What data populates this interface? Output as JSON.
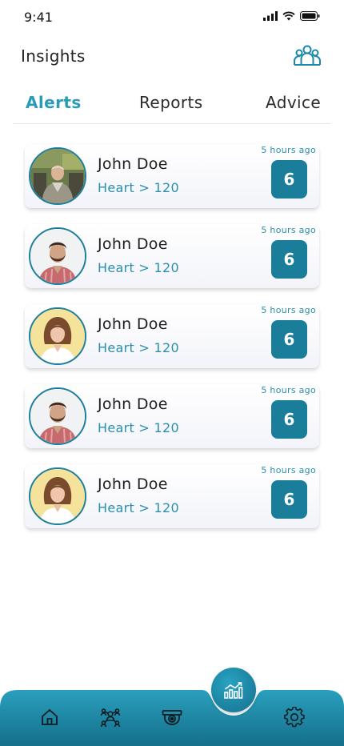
{
  "status_bar": {
    "time": "9:41"
  },
  "header": {
    "title": "Insights",
    "icon": "group-icon"
  },
  "tabs": [
    {
      "label": "Alerts",
      "active": true
    },
    {
      "label": "Reports",
      "active": false
    },
    {
      "label": "Advice",
      "active": false
    }
  ],
  "alerts": [
    {
      "name": "John Doe",
      "metric": "Heart > 120",
      "time": "5 hours ago",
      "count": "6",
      "avatar": "elderly-man-photo"
    },
    {
      "name": "John Doe",
      "metric": "Heart > 120",
      "time": "5 hours ago",
      "count": "6",
      "avatar": "bearded-man-photo"
    },
    {
      "name": "John Doe",
      "metric": "Heart > 120",
      "time": "5 hours ago",
      "count": "6",
      "avatar": "woman-photo"
    },
    {
      "name": "John Doe",
      "metric": "Heart > 120",
      "time": "5 hours ago",
      "count": "6",
      "avatar": "bearded-man-photo"
    },
    {
      "name": "John Doe",
      "metric": "Heart > 120",
      "time": "5 hours ago",
      "count": "6",
      "avatar": "woman-photo"
    }
  ],
  "bottom_nav": {
    "items": [
      "home-icon",
      "people-network-icon",
      "camera-icon",
      "insights-chart-icon",
      "settings-icon"
    ],
    "active": "insights-chart-icon"
  },
  "colors": {
    "accent": "#2a9bb8",
    "badge": "#1a7d9a",
    "nav_top": "#2a9fbd",
    "nav_bottom": "#146f8b"
  }
}
